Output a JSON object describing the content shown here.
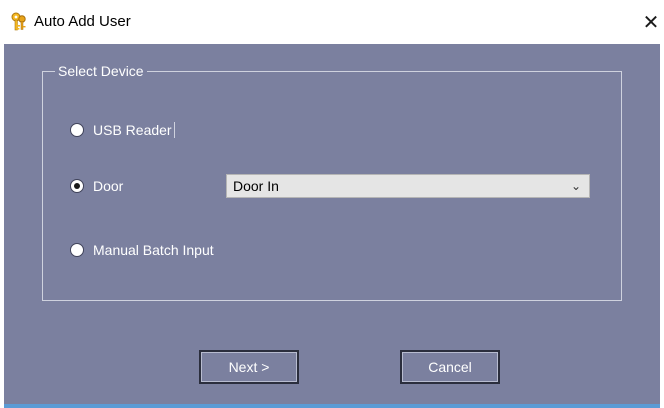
{
  "window": {
    "title": "Auto Add User",
    "close_symbol": "✕",
    "icon": "keys-icon"
  },
  "group": {
    "legend": "Select Device",
    "options": [
      {
        "label": "USB Reader",
        "selected": false
      },
      {
        "label": "Door",
        "selected": true
      },
      {
        "label": "Manual Batch Input",
        "selected": false
      }
    ],
    "door_select": {
      "value": "Door In",
      "arrow": "⌄"
    }
  },
  "buttons": {
    "next_label": "Next >",
    "cancel_label": "Cancel"
  },
  "colors": {
    "client_background": "#7b809f",
    "title_background": "#ffffff",
    "bottom_border": "#5b9bd5"
  }
}
